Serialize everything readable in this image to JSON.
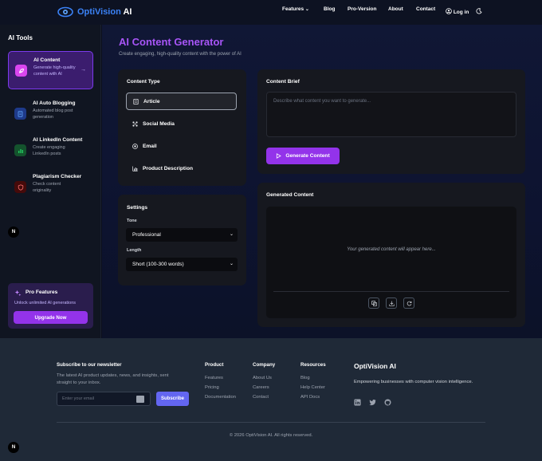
{
  "header": {
    "brand": "OptiVision",
    "brand_ai": "AI",
    "nav": {
      "features": "Features",
      "blog": "Blog",
      "pro": "Pro-Version",
      "about": "About",
      "contact": "Contact",
      "login": "Log in"
    }
  },
  "sidebar": {
    "title": "AI Tools",
    "items": [
      {
        "name": "AI Content",
        "desc": "Generate high-quality content with AI"
      },
      {
        "name": "AI Auto Blogging",
        "desc": "Automated blog post generation"
      },
      {
        "name": "AI LinkedIn Content",
        "desc": "Create engaging LinkedIn posts"
      },
      {
        "name": "Plagiarism Checker",
        "desc": "Check content originality"
      }
    ],
    "pro": {
      "title": "Pro Features",
      "desc": "Unlock unlimited AI generations",
      "button": "Upgrade Now"
    }
  },
  "badge_letter": "N",
  "main": {
    "title": "AI Content Generator",
    "subtitle": "Create engaging, high-quality content with the power of AI",
    "content_type": {
      "title": "Content Type",
      "items": [
        "Article",
        "Social Media",
        "Email",
        "Product Description"
      ]
    },
    "settings": {
      "title": "Settings",
      "tone_label": "Tone",
      "tone_value": "Professional",
      "length_label": "Length",
      "length_value": "Short (100-300 words)"
    },
    "brief": {
      "title": "Content Brief",
      "placeholder": "Describe what content you want to generate...",
      "button": "Generate Content"
    },
    "generated": {
      "title": "Generated Content",
      "placeholder": "Your generated content will appear here..."
    }
  },
  "footer": {
    "newsletter_title": "Subscribe to our newsletter",
    "newsletter_desc": "The latest AI product updates, news, and insights, sent straight to your inbox.",
    "email_placeholder": "Enter your email",
    "subscribe": "Subscribe",
    "columns": [
      {
        "title": "Product",
        "links": [
          "Features",
          "Pricing",
          "Documentation"
        ]
      },
      {
        "title": "Company",
        "links": [
          "About Us",
          "Careers",
          "Contact"
        ]
      },
      {
        "title": "Resources",
        "links": [
          "Blog",
          "Help Center",
          "API Docs"
        ]
      }
    ],
    "brand": "OptiVision AI",
    "tagline": "Empowering businesses with computer vision intelligence.",
    "copyright": "© 2026 OptiVision AI. All rights reserved."
  },
  "colors": {
    "accent": "#9333ea",
    "brand_blue": "#3b82f6",
    "subscribe": "#6366f1"
  }
}
